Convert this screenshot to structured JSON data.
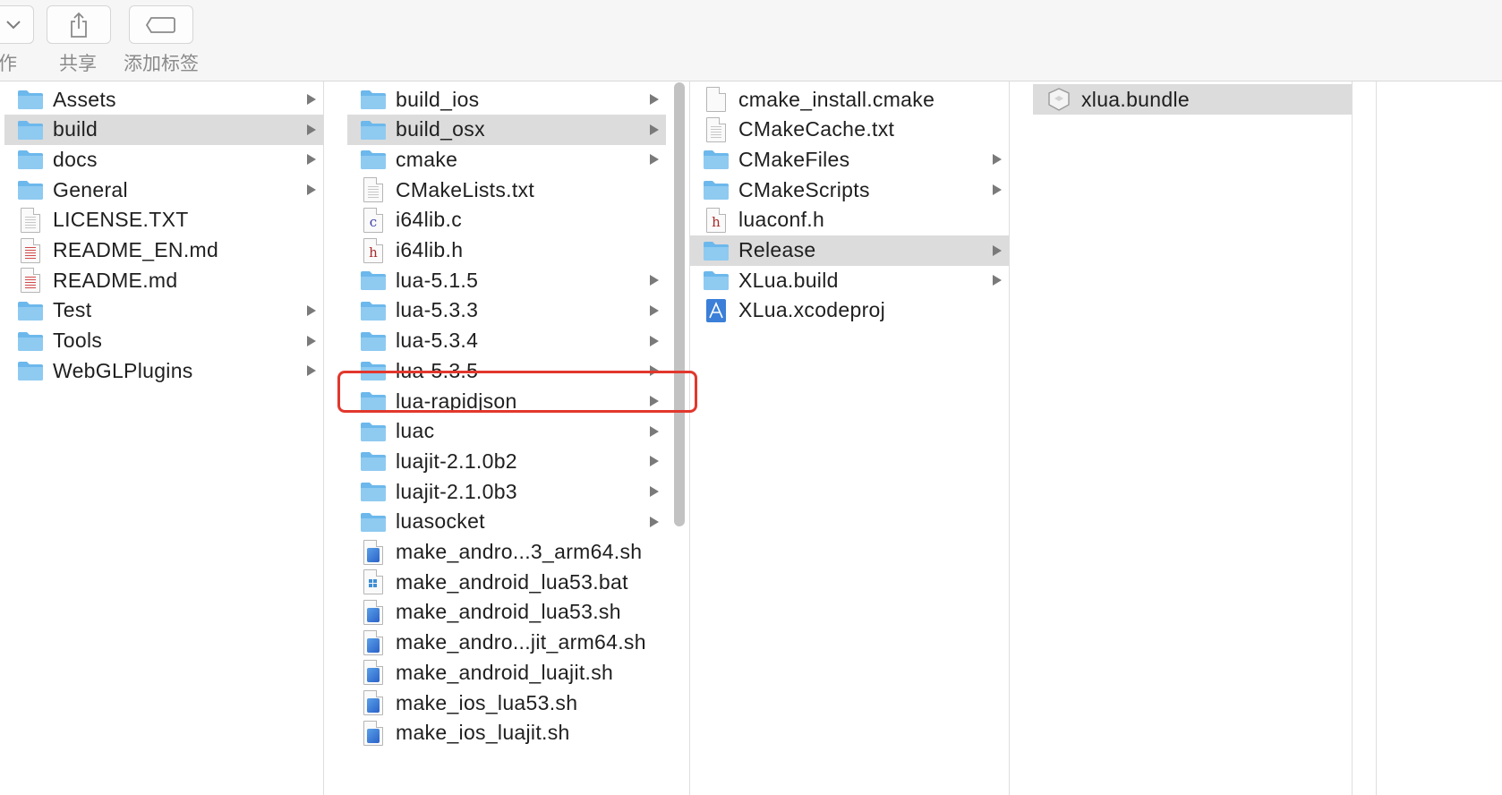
{
  "toolbar": {
    "cut_label": "作",
    "share_label": "共享",
    "tag_label": "添加标签"
  },
  "columns": [
    {
      "items": [
        {
          "label": "Assets",
          "type": "folder",
          "arrow": true,
          "selected": false
        },
        {
          "label": "build",
          "type": "folder",
          "arrow": true,
          "selected": true
        },
        {
          "label": "docs",
          "type": "folder",
          "arrow": true,
          "selected": false
        },
        {
          "label": "General",
          "type": "folder",
          "arrow": true,
          "selected": false
        },
        {
          "label": "LICENSE.TXT",
          "type": "text",
          "arrow": false,
          "selected": false
        },
        {
          "label": "README_EN.md",
          "type": "markdown",
          "arrow": false,
          "selected": false
        },
        {
          "label": "README.md",
          "type": "markdown",
          "arrow": false,
          "selected": false
        },
        {
          "label": "Test",
          "type": "folder",
          "arrow": true,
          "selected": false
        },
        {
          "label": "Tools",
          "type": "folder",
          "arrow": true,
          "selected": false
        },
        {
          "label": "WebGLPlugins",
          "type": "folder",
          "arrow": true,
          "selected": false
        }
      ]
    },
    {
      "items": [
        {
          "label": "build_ios",
          "type": "folder",
          "arrow": true,
          "selected": false
        },
        {
          "label": "build_osx",
          "type": "folder",
          "arrow": true,
          "selected": true
        },
        {
          "label": "cmake",
          "type": "folder",
          "arrow": true,
          "selected": false
        },
        {
          "label": "CMakeLists.txt",
          "type": "text",
          "arrow": false,
          "selected": false
        },
        {
          "label": "i64lib.c",
          "type": "c-source",
          "arrow": false,
          "selected": false
        },
        {
          "label": "i64lib.h",
          "type": "header",
          "arrow": false,
          "selected": false
        },
        {
          "label": "lua-5.1.5",
          "type": "folder",
          "arrow": true,
          "selected": false
        },
        {
          "label": "lua-5.3.3",
          "type": "folder",
          "arrow": true,
          "selected": false
        },
        {
          "label": "lua-5.3.4",
          "type": "folder",
          "arrow": true,
          "selected": false
        },
        {
          "label": "lua-5.3.5",
          "type": "folder",
          "arrow": true,
          "selected": false
        },
        {
          "label": "lua-rapidjson",
          "type": "folder",
          "arrow": true,
          "selected": false
        },
        {
          "label": "luac",
          "type": "folder",
          "arrow": true,
          "selected": false
        },
        {
          "label": "luajit-2.1.0b2",
          "type": "folder",
          "arrow": true,
          "selected": false
        },
        {
          "label": "luajit-2.1.0b3",
          "type": "folder",
          "arrow": true,
          "selected": false
        },
        {
          "label": "luasocket",
          "type": "folder",
          "arrow": true,
          "selected": false
        },
        {
          "label": "make_andro...3_arm64.sh",
          "type": "shell",
          "arrow": false,
          "selected": false
        },
        {
          "label": "make_android_lua53.bat",
          "type": "batch",
          "arrow": false,
          "selected": false
        },
        {
          "label": "make_android_lua53.sh",
          "type": "shell",
          "arrow": false,
          "selected": false
        },
        {
          "label": "make_andro...jit_arm64.sh",
          "type": "shell",
          "arrow": false,
          "selected": false
        },
        {
          "label": "make_android_luajit.sh",
          "type": "shell",
          "arrow": false,
          "selected": false
        },
        {
          "label": "make_ios_lua53.sh",
          "type": "shell",
          "arrow": false,
          "selected": false
        },
        {
          "label": "make_ios_luajit.sh",
          "type": "shell",
          "arrow": false,
          "selected": false
        }
      ]
    },
    {
      "items": [
        {
          "label": "cmake_install.cmake",
          "type": "blank",
          "arrow": false,
          "selected": false
        },
        {
          "label": "CMakeCache.txt",
          "type": "text",
          "arrow": false,
          "selected": false
        },
        {
          "label": "CMakeFiles",
          "type": "folder",
          "arrow": true,
          "selected": false
        },
        {
          "label": "CMakeScripts",
          "type": "folder",
          "arrow": true,
          "selected": false
        },
        {
          "label": "luaconf.h",
          "type": "header",
          "arrow": false,
          "selected": false
        },
        {
          "label": "Release",
          "type": "folder",
          "arrow": true,
          "selected": true
        },
        {
          "label": "XLua.build",
          "type": "folder",
          "arrow": true,
          "selected": false
        },
        {
          "label": "XLua.xcodeproj",
          "type": "xcodeproj",
          "arrow": false,
          "selected": false
        }
      ]
    },
    {
      "items": [
        {
          "label": "xlua.bundle",
          "type": "bundle",
          "arrow": false,
          "selected": true
        }
      ]
    }
  ],
  "annotation": {
    "highlighted_item": "lua-rapidjson",
    "color": "#e2372d"
  },
  "colors": {
    "folder": "#6cb8ec",
    "folder_tab": "#8fcaf1",
    "selection": "#dcdcdc",
    "arrow": "#7a7a7a"
  }
}
